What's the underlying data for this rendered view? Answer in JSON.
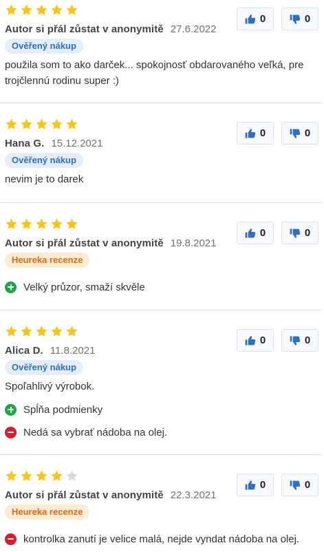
{
  "colors": {
    "star_filled": "#f5c518",
    "star_empty": "#d9d9d9",
    "thumb": "#2f6fc0",
    "verified_bg": "#e4eefb",
    "verified_text": "#2f6fc0",
    "heureka_bg": "#fdebd2",
    "heureka_text": "#e06a12",
    "pro": "#1ea545",
    "con": "#d2202f"
  },
  "reviews": [
    {
      "rating": 5,
      "author": "Autor si přál zůstat v anonymitě",
      "date": "27.6.2022",
      "badge": "Ověřený nákup",
      "text": "použila som to ako darček... spokojnosť obdarovaného veľká, pre trojčlennú rodinu super :)",
      "pros": [],
      "cons": [],
      "likes": "0",
      "dislikes": "0"
    },
    {
      "rating": 5,
      "author": "Hana G.",
      "date": "15.12.2021",
      "badge": "Ověřený nákup",
      "text": "nevim je to darek",
      "pros": [],
      "cons": [],
      "likes": "0",
      "dislikes": "0"
    },
    {
      "rating": 5,
      "author": "Autor si přál zůstat v anonymitě",
      "date": "19.8.2021",
      "badge": "Heureka recenze",
      "text": "",
      "pros": [
        "Velký průzor, smaží skvěle"
      ],
      "cons": [],
      "likes": "0",
      "dislikes": "0"
    },
    {
      "rating": 5,
      "author": "Alica D.",
      "date": "11.8.2021",
      "badge": "Ověřený nákup",
      "text": "Spoľahlivý výrobok.",
      "pros": [
        "Spĺňa podmienky"
      ],
      "cons": [
        "Nedá sa vybrať nádoba na olej."
      ],
      "likes": "0",
      "dislikes": "0"
    },
    {
      "rating": 4,
      "author": "Autor si přál zůstat v anonymitě",
      "date": "22.3.2021",
      "badge": "Heureka recenze",
      "text": "",
      "pros": [],
      "cons": [
        "kontrolka zanutí je velice malá, nejde vyndat nádoba na olej."
      ],
      "likes": "0",
      "dislikes": "0"
    }
  ]
}
